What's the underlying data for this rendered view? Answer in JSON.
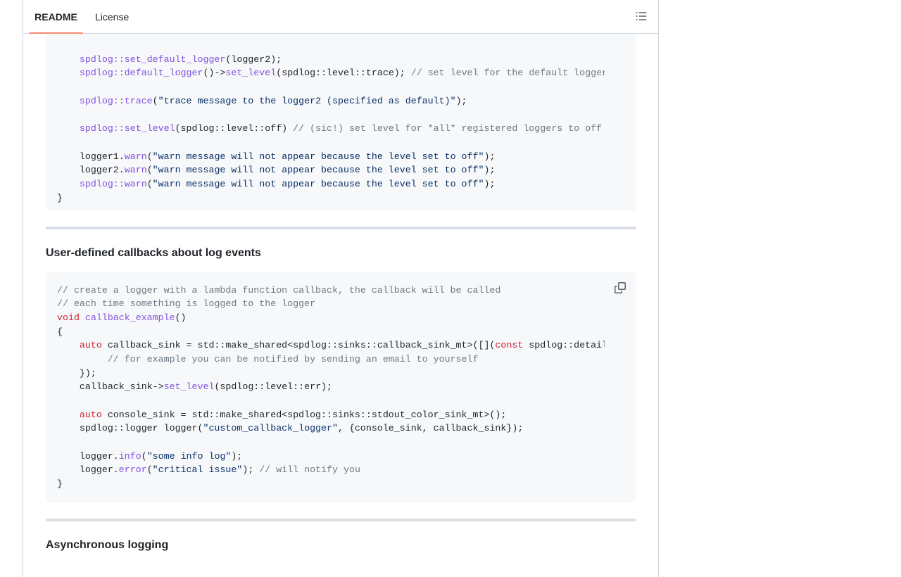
{
  "tabs": {
    "readme": "README",
    "license": "License"
  },
  "icons": {
    "outline": "list-unordered-icon",
    "copy": "copy-icon"
  },
  "colors": {
    "keyword": "#cf222e",
    "function": "#8250df",
    "string": "#0a3069",
    "comment": "#6e7781",
    "tab_underline": "#fd8c73"
  },
  "block1": [
    "",
    "    <f>spdlog::set_default_logger</f>(logger2);",
    "    <f>spdlog::default_logger</f>()-><f>set_level</f>(spdlog::level::trace); <c>// set level for the default logger</c>",
    "",
    "    <f>spdlog::trace</f>(<s>\"trace message to the logger2 (specified as default)\"</s>);",
    "",
    "    <f>spdlog::set_level</f>(spdlog::level::off) <c>// (sic!) set level for *all* registered loggers to off</c>",
    "",
    "    logger1.<f>warn</f>(<s>\"warn message will not appear because the level set to off\"</s>);",
    "    logger2.<f>warn</f>(<s>\"warn message will not appear because the level set to off\"</s>);",
    "    <f>spdlog::warn</f>(<s>\"warn message will not appear because the level set to off\"</s>);",
    "}"
  ],
  "heading1": "User-defined callbacks about log events",
  "block2": [
    "<c>// create a logger with a lambda function callback, the callback will be called</c>",
    "<c>// each time something is logged to the logger</c>",
    "<k>void</k> <f>callback_example</f>()",
    "{",
    "    <k>auto</k> callback_sink = std::make_shared<spdlog::sinks::callback_sink_mt>([](<k>const</k> spdlog::details::log_msg &msg) {",
    "         <c>// for example you can be notified by sending an email to yourself</c>",
    "    });",
    "    callback_sink-><f>set_level</f>(spdlog::level::err);",
    "",
    "    <k>auto</k> console_sink = std::make_shared<spdlog::sinks::stdout_color_sink_mt>();",
    "    spdlog::logger logger(<s>\"custom_callback_logger\"</s>, {console_sink, callback_sink});",
    "",
    "    logger.<f>info</f>(<s>\"some info log\"</s>);",
    "    logger.<f>error</f>(<s>\"critical issue\"</s>); <c>// will notify you</c>",
    "}"
  ],
  "heading2": "Asynchronous logging"
}
